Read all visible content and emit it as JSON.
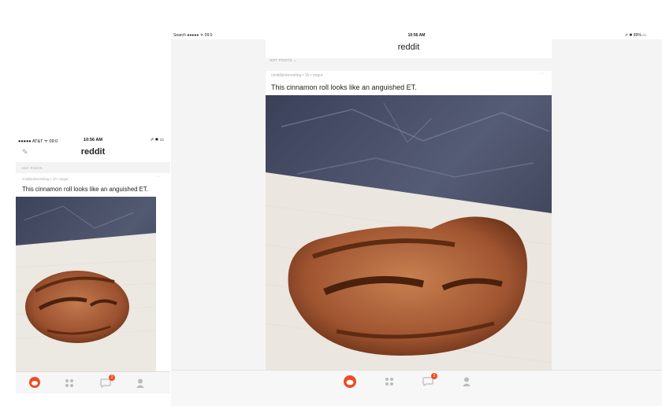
{
  "phone": {
    "status": {
      "left": "●●●●● AT&T ᯤ 09:0",
      "time": "10:56 AM",
      "right": "⇗ ✱ ▭"
    },
    "nav": {
      "title": "reddit"
    },
    "sort": {
      "label": "HOT POSTS"
    },
    "post": {
      "meta": "cmildlyinteresting • 1h • imgur",
      "title": "This cinnamon roll looks like an anguished ET."
    },
    "tabbar": {
      "inbox_badge": "2"
    }
  },
  "tablet": {
    "status": {
      "left": "Search ●●●●● ᯤ 09:0",
      "time": "10:56 AM",
      "right": "⇗ ✱ 89% ▭"
    },
    "nav": {
      "title": "reddit"
    },
    "sort": {
      "label": "HOT POSTS"
    },
    "post": {
      "meta": "cmildlyinteresting • 1h • imgur",
      "title": "This cinnamon roll looks like an anguished ET."
    },
    "tabbar": {
      "inbox_badge": "2"
    }
  },
  "colors": {
    "accent": "#f04a24",
    "bg": "#f4f4f4"
  },
  "icons": [
    "pencil-icon",
    "reddit-home-icon",
    "grid-icon",
    "inbox-icon",
    "profile-icon",
    "more-icon"
  ]
}
